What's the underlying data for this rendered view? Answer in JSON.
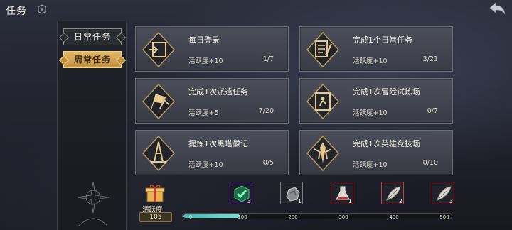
{
  "header": {
    "title": "任务"
  },
  "sidebar": {
    "tabs": [
      {
        "label": "日常任务",
        "active": false
      },
      {
        "label": "周常任务",
        "active": true
      }
    ]
  },
  "tasks": [
    {
      "name": "每日登录",
      "reward": "活跃度+10",
      "progress": "1/7",
      "icon": "door-exit-icon"
    },
    {
      "name": "完成1个日常任务",
      "reward": "活跃度+10",
      "progress": "3/21",
      "icon": "quest-scroll-icon"
    },
    {
      "name": "完成1次派遣任务",
      "reward": "活跃度+5",
      "progress": "7/20",
      "icon": "dispatch-flags-icon"
    },
    {
      "name": "完成1次冒险试炼场",
      "reward": "活跃度+10",
      "progress": "0/7",
      "icon": "trial-portal-icon"
    },
    {
      "name": "提炼1次黑塔徽记",
      "reward": "活跃度+10",
      "progress": "0/5",
      "icon": "black-tower-icon"
    },
    {
      "name": "完成1次英雄竞技场",
      "reward": "活跃度+10",
      "progress": "0/10",
      "icon": "hero-arena-icon"
    }
  ],
  "activity": {
    "label": "活跃度",
    "value": "105",
    "progress_fraction": 0.21,
    "milestones": [
      {
        "label": "0"
      },
      {
        "label": "100",
        "count": "3",
        "state": "claimed"
      },
      {
        "label": "200",
        "count": "1",
        "state": "locked"
      },
      {
        "label": "300",
        "count": "1",
        "state": "locked"
      },
      {
        "label": "400",
        "count": "2",
        "state": "locked"
      },
      {
        "label": "500",
        "count": "3",
        "state": "locked"
      }
    ]
  },
  "colors": {
    "accent_gold": "#c4923f",
    "progress_teal": "#4ccfc8",
    "claimed_border": "#9b5cd6",
    "locked_border": "#c0404a"
  }
}
